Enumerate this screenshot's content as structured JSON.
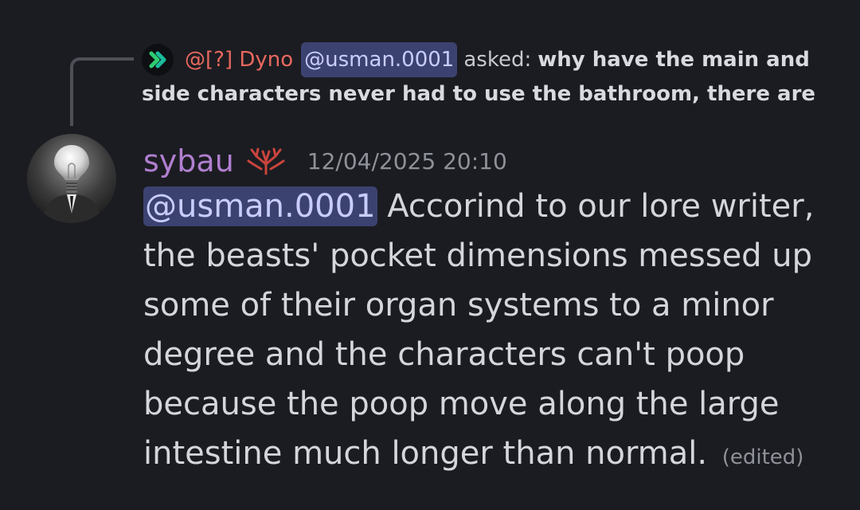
{
  "reply": {
    "author": "@[?] Dyno",
    "mention": "@usman.0001",
    "asked": "asked:",
    "preview_line1": "why have the main and",
    "preview_line2": "side characters never had to use the bathroom, there are",
    "avatar_icon": "dyno-bot-avatar",
    "author_color": "#e8685f"
  },
  "message": {
    "username": "sybau",
    "username_color": "#b07fd0",
    "role_icon": "coral-icon",
    "timestamp": "12/04/2025 20:10",
    "mention": "@usman.0001",
    "line1": " Accorind to our lore writer,",
    "line2": "the beasts' pocket dimensions messed up",
    "line3": "some of their organ systems to a minor",
    "line4": "degree and the characters can't poop",
    "line5": "because the poop move along the large",
    "line6": "intestine much longer than normal.",
    "edited": "(edited)",
    "mention_bg": "#3c4270"
  }
}
